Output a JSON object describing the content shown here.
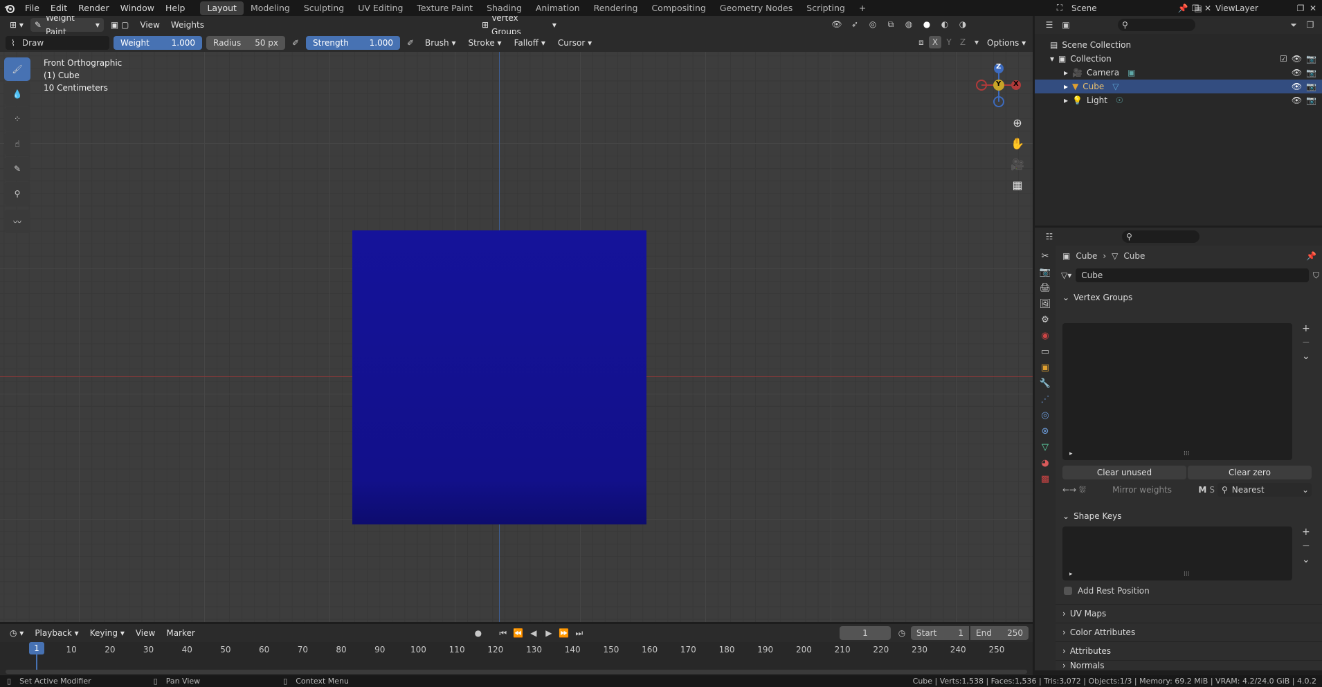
{
  "menu": [
    "File",
    "Edit",
    "Render",
    "Window",
    "Help"
  ],
  "workspaces": [
    "Layout",
    "Modeling",
    "Sculpting",
    "UV Editing",
    "Texture Paint",
    "Shading",
    "Animation",
    "Rendering",
    "Compositing",
    "Geometry Nodes",
    "Scripting"
  ],
  "add_tab": "+",
  "scene": "Scene",
  "view_layer": "ViewLayer",
  "header": {
    "mode": "Weight Paint",
    "view": "View",
    "weights": "Weights",
    "vertex_groups": "Vertex Groups"
  },
  "tool_header": {
    "tool": "Draw",
    "weight_label": "Weight",
    "weight_value": "1.000",
    "radius_label": "Radius",
    "radius_value": "50 px",
    "strength_label": "Strength",
    "strength_value": "1.000",
    "brush": "Brush",
    "stroke": "Stroke",
    "falloff": "Falloff",
    "cursor": "Cursor",
    "options": "Options",
    "x": "X",
    "y": "Y",
    "z": "Z"
  },
  "viewport_info": {
    "line1": "Front Orthographic",
    "line2": "(1) Cube",
    "line3": "10 Centimeters"
  },
  "gizmo": {
    "z": "Z",
    "y": "Y",
    "x": "X"
  },
  "outliner": {
    "scene_collection": "Scene Collection",
    "collection": "Collection",
    "items": [
      "Camera",
      "Cube",
      "Light"
    ]
  },
  "properties": {
    "breadcrumb_obj": "Cube",
    "breadcrumb_data": "Cube",
    "data_name": "Cube",
    "vertex_groups": "Vertex Groups",
    "clear_unused": "Clear unused",
    "clear_zero": "Clear zero",
    "mirror_weights": "Mirror weights",
    "m": "M",
    "s": "S",
    "nearest": "Nearest",
    "shape_keys": "Shape Keys",
    "add_rest_position": "Add Rest Position",
    "uv_maps": "UV Maps",
    "color_attributes": "Color Attributes",
    "attributes": "Attributes",
    "normals": "Normals"
  },
  "timeline": {
    "playback": "Playback",
    "keying": "Keying",
    "view": "View",
    "marker": "Marker",
    "current_frame": "1",
    "start_label": "Start",
    "start": "1",
    "end_label": "End",
    "end": "250",
    "frames": [
      "1",
      "10",
      "20",
      "30",
      "40",
      "50",
      "60",
      "70",
      "80",
      "90",
      "100",
      "110",
      "120",
      "130",
      "140",
      "150",
      "160",
      "170",
      "180",
      "190",
      "200",
      "210",
      "220",
      "230",
      "240",
      "250"
    ]
  },
  "status": {
    "left1": "Set Active Modifier",
    "left2": "Pan View",
    "left3": "Context Menu",
    "right": "Cube | Verts:1,538 | Faces:1,536 | Tris:3,072 | Objects:1/3 | Memory: 69.2 MiB | VRAM: 4.2/24.0 GiB | 4.0.2"
  },
  "colors": {
    "accent": "#4772b3",
    "cube": "#13118f",
    "x_axis": "#9c3a3a",
    "y_axis": "#3a5a9c"
  }
}
